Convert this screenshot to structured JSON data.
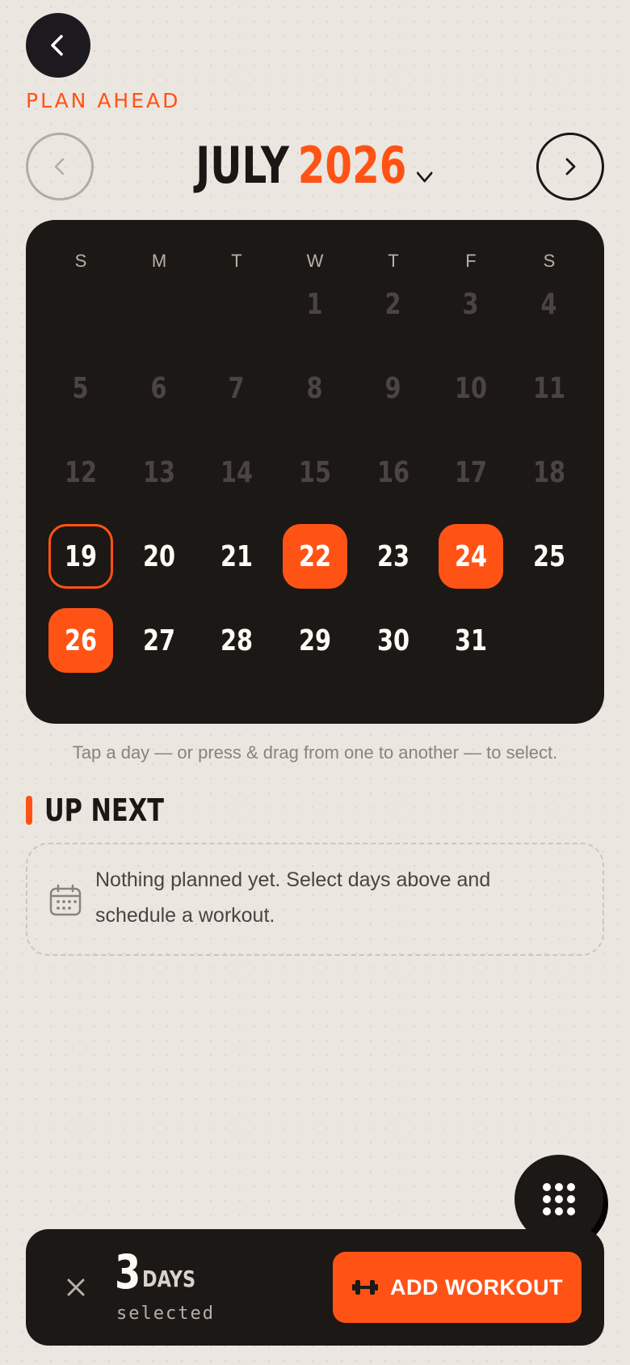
{
  "header": {
    "eyebrow": "PLAN AHEAD",
    "month": "JULY",
    "year": "2026"
  },
  "calendar": {
    "weekdays": [
      "S",
      "M",
      "T",
      "W",
      "T",
      "F",
      "S"
    ],
    "days": [
      {
        "n": "1",
        "state": "past"
      },
      {
        "n": "2",
        "state": "past"
      },
      {
        "n": "3",
        "state": "past"
      },
      {
        "n": "4",
        "state": "past"
      },
      {
        "n": "5",
        "state": "past"
      },
      {
        "n": "6",
        "state": "past"
      },
      {
        "n": "7",
        "state": "past"
      },
      {
        "n": "8",
        "state": "past"
      },
      {
        "n": "9",
        "state": "past"
      },
      {
        "n": "10",
        "state": "past"
      },
      {
        "n": "11",
        "state": "past"
      },
      {
        "n": "12",
        "state": "past"
      },
      {
        "n": "13",
        "state": "past"
      },
      {
        "n": "14",
        "state": "past"
      },
      {
        "n": "15",
        "state": "past"
      },
      {
        "n": "16",
        "state": "past"
      },
      {
        "n": "17",
        "state": "past"
      },
      {
        "n": "18",
        "state": "past"
      },
      {
        "n": "19",
        "state": "today"
      },
      {
        "n": "20",
        "state": "future"
      },
      {
        "n": "21",
        "state": "future"
      },
      {
        "n": "22",
        "state": "selected"
      },
      {
        "n": "23",
        "state": "future"
      },
      {
        "n": "24",
        "state": "selected"
      },
      {
        "n": "25",
        "state": "future"
      },
      {
        "n": "26",
        "state": "selected"
      },
      {
        "n": "27",
        "state": "future"
      },
      {
        "n": "28",
        "state": "future"
      },
      {
        "n": "29",
        "state": "future"
      },
      {
        "n": "30",
        "state": "future"
      },
      {
        "n": "31",
        "state": "future"
      }
    ]
  },
  "hint": "Tap a day — or press & drag from one to another — to select.",
  "up_next": {
    "title": "UP NEXT",
    "empty_text": "Nothing planned yet. Select days above and schedule a workout."
  },
  "selection": {
    "count": "3",
    "unit": "DAYS",
    "label": "selected",
    "action": "ADD WORKOUT"
  },
  "icons": {
    "back": "chevron-left-icon",
    "prev": "chevron-left-icon",
    "next": "chevron-right-icon",
    "month_picker": "chevron-down-icon",
    "empty": "calendar-icon",
    "fab": "grid-dots-icon",
    "clear": "close-icon",
    "add": "dumbbell-icon"
  },
  "colors": {
    "accent": "#ff5316",
    "dark": "#1c1816",
    "background": "#ebe6e0"
  }
}
